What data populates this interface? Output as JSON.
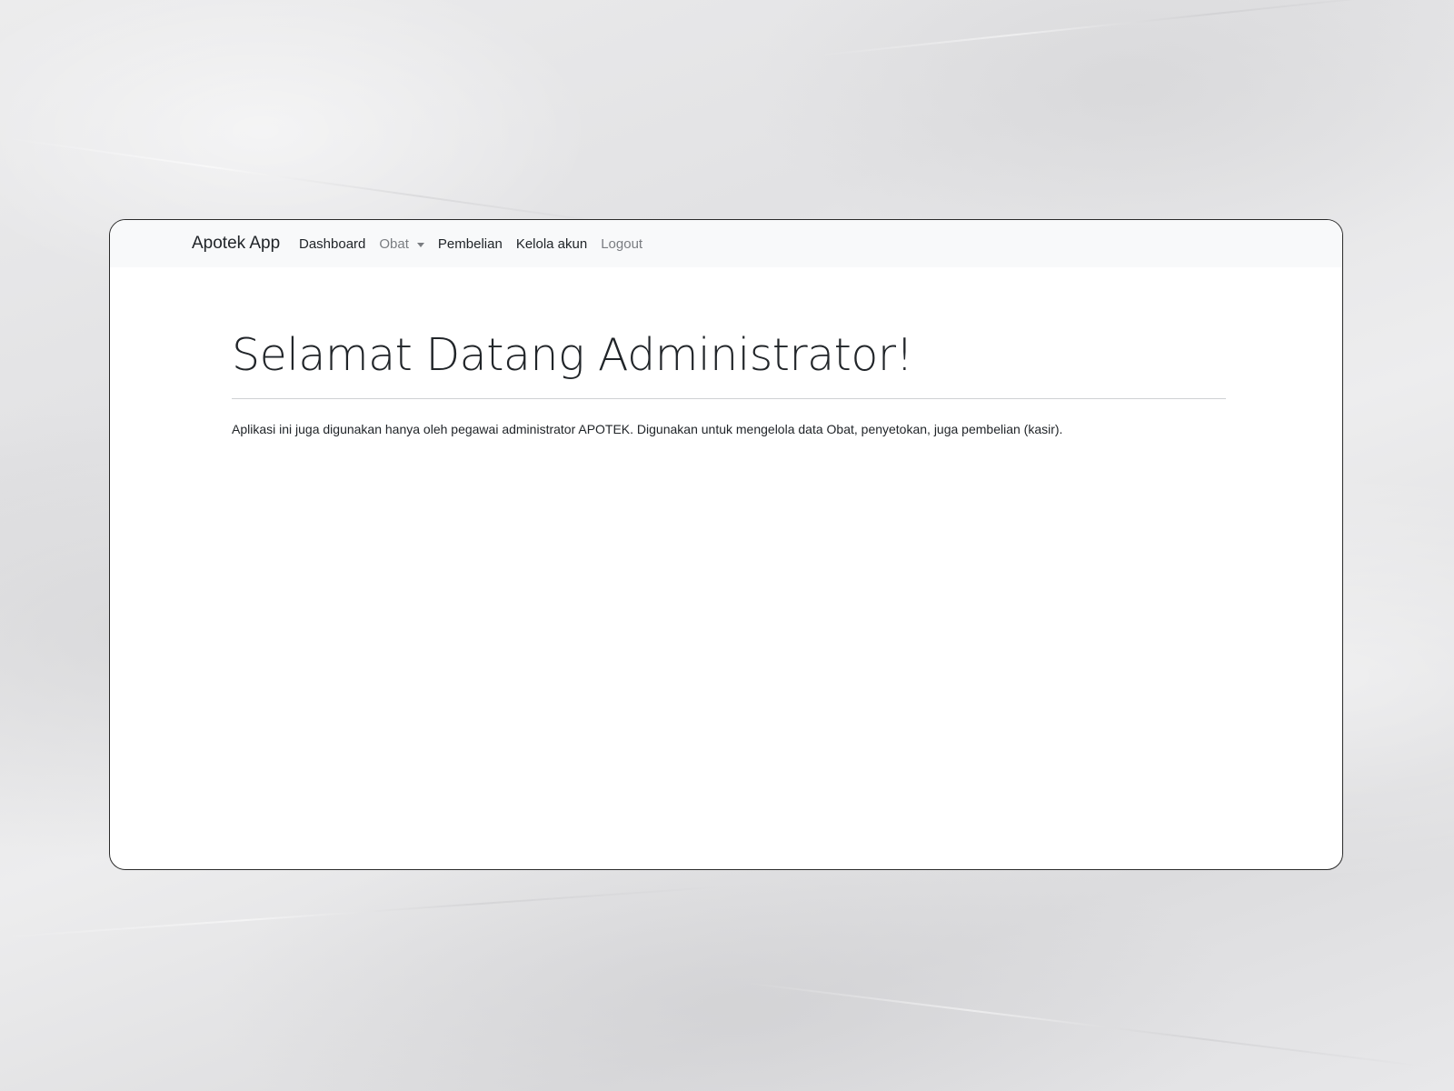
{
  "navbar": {
    "brand": "Apotek App",
    "items": [
      {
        "label": "Dashboard"
      },
      {
        "label": "Obat"
      },
      {
        "label": "Pembelian"
      },
      {
        "label": "Kelola akun"
      },
      {
        "label": "Logout"
      }
    ]
  },
  "main": {
    "title": "Selamat Datang Administrator!",
    "description": "Aplikasi ini juga digunakan hanya oleh pegawai administrator APOTEK. Digunakan untuk mengelola data Obat, penyetokan, juga pembelian (kasir)."
  },
  "colors": {
    "navbar_bg": "#f8f9fa",
    "text": "#212529",
    "muted_link": "#7a7d81",
    "page_background": "#e6e6e8"
  }
}
